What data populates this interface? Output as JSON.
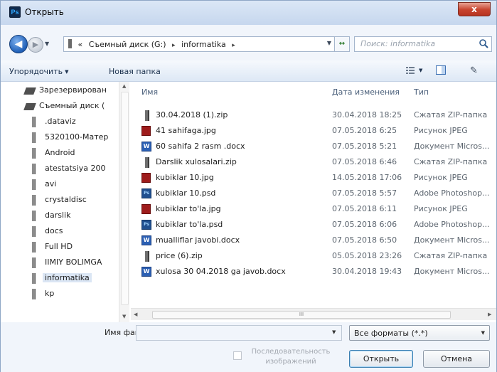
{
  "window": {
    "title": "Открыть",
    "app_icon_text": "Ps",
    "close_glyph": "x"
  },
  "address": {
    "back_glyph": "◀",
    "forward_glyph": "▶",
    "dropdown_glyph": "▼",
    "overflow_glyph": "«",
    "crumbs": [
      "Съемный диск (G:)",
      "informatika"
    ],
    "separator": "▸",
    "refresh_glyph": "↔"
  },
  "search": {
    "placeholder": "Поиск: informatika"
  },
  "toolbar": {
    "organize_label": "Упорядочить",
    "organize_arrow": "▼",
    "new_folder_label": "Новая папка",
    "views_arrow": "▼",
    "help_glyph": "✎"
  },
  "nav": {
    "items": [
      {
        "label": "Зарезервирован",
        "icon": "drive-icon"
      },
      {
        "label": "Съемный диск (",
        "icon": "drive-icon"
      },
      {
        "label": ".dataviz",
        "icon": "folder-icon"
      },
      {
        "label": "5320100-Матер",
        "icon": "folder-icon"
      },
      {
        "label": "Android",
        "icon": "folder-icon"
      },
      {
        "label": "atestatsiya 200",
        "icon": "folder-icon"
      },
      {
        "label": "avi",
        "icon": "folder-icon"
      },
      {
        "label": "crystaldisc",
        "icon": "folder-icon"
      },
      {
        "label": "darslik",
        "icon": "folder-icon"
      },
      {
        "label": "docs",
        "icon": "folder-icon"
      },
      {
        "label": "Full HD",
        "icon": "folder-icon"
      },
      {
        "label": "IIMIY BOLIMGA",
        "icon": "folder-icon"
      },
      {
        "label": "informatika",
        "icon": "folder-icon"
      },
      {
        "label": "kp",
        "icon": "folder-icon"
      }
    ],
    "scroll_up": "▲",
    "scroll_down": "▼"
  },
  "filelist": {
    "columns": {
      "name": "Имя",
      "date": "Дата изменения",
      "type": "Тип"
    },
    "rows": [
      {
        "name": "30.04.2018 (1).zip",
        "date": "30.04.2018 18:25",
        "type": "Сжатая ZIP-папка",
        "icon": "zip-icon"
      },
      {
        "name": "41 sahifaga.jpg",
        "date": "07.05.2018 6:25",
        "type": "Рисунок JPEG",
        "icon": "jpg-icon"
      },
      {
        "name": "60 sahifa 2 rasm .docx",
        "date": "07.05.2018 5:21",
        "type": "Документ Micros...",
        "icon": "docx-icon"
      },
      {
        "name": "Darslik xulosalari.zip",
        "date": "07.05.2018 6:46",
        "type": "Сжатая ZIP-папка",
        "icon": "zip-icon"
      },
      {
        "name": "kubiklar 10.jpg",
        "date": "14.05.2018 17:06",
        "type": "Рисунок JPEG",
        "icon": "jpg-icon"
      },
      {
        "name": "kubiklar 10.psd",
        "date": "07.05.2018 5:57",
        "type": "Adobe Photoshop...",
        "icon": "psd-icon"
      },
      {
        "name": "kubiklar to'la.jpg",
        "date": "07.05.2018 6:11",
        "type": "Рисунок JPEG",
        "icon": "jpg-icon"
      },
      {
        "name": "kubiklar to'la.psd",
        "date": "07.05.2018 6:06",
        "type": "Adobe Photoshop...",
        "icon": "psd-icon"
      },
      {
        "name": "mualliflar javobi.docx",
        "date": "07.05.2018 6:50",
        "type": "Документ Micros...",
        "icon": "docx-icon"
      },
      {
        "name": "price (6).zip",
        "date": "05.05.2018 23:26",
        "type": "Сжатая ZIP-папка",
        "icon": "zip-icon"
      },
      {
        "name": "xulosa 30 04.2018 ga javob.docx",
        "date": "30.04.2018 19:43",
        "type": "Документ Micros...",
        "icon": "docx-icon"
      }
    ],
    "hscroll_grip": "III",
    "hscroll_left": "◀",
    "hscroll_right": "▶"
  },
  "bottom": {
    "filename_label": "Имя файла:",
    "filename_value": "",
    "filename_drop": "▼",
    "filter_value": "Все форматы (*.*)",
    "filter_drop": "▼",
    "sequence_label": "Последовательность изображений",
    "open_label": "Открыть",
    "cancel_label": "Отмена"
  }
}
